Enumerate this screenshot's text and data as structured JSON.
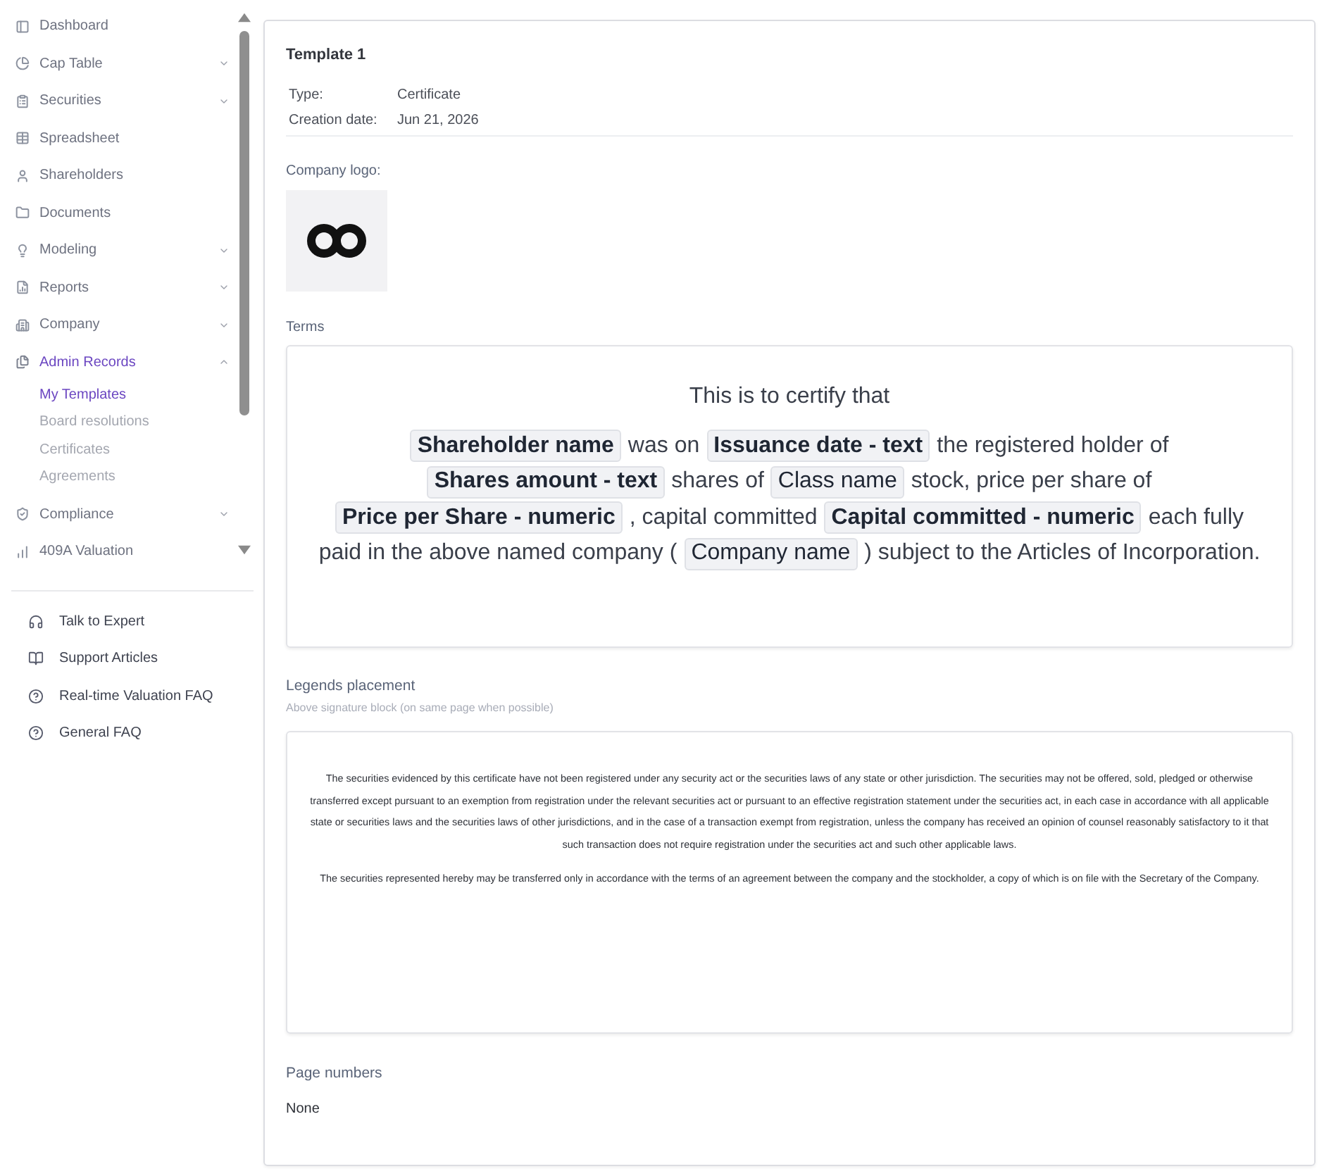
{
  "sidebar": {
    "items": [
      {
        "label": "Dashboard",
        "kind": "link",
        "selected": false
      },
      {
        "label": "Cap Table",
        "kind": "group",
        "selected": false,
        "expanded": false
      },
      {
        "label": "Securities",
        "kind": "group",
        "selected": false,
        "expanded": false
      },
      {
        "label": "Spreadsheet",
        "kind": "link",
        "selected": false
      },
      {
        "label": "Shareholders",
        "kind": "link",
        "selected": false
      },
      {
        "label": "Documents",
        "kind": "link",
        "selected": false
      },
      {
        "label": "Modeling",
        "kind": "group",
        "selected": false,
        "expanded": false
      },
      {
        "label": "Reports",
        "kind": "group",
        "selected": false,
        "expanded": false
      },
      {
        "label": "Company",
        "kind": "group",
        "selected": false,
        "expanded": false
      },
      {
        "label": "Admin Records",
        "kind": "group",
        "selected": true,
        "expanded": true,
        "children": [
          {
            "label": "My Templates",
            "selected": true
          },
          {
            "label": "Board resolutions",
            "selected": false
          },
          {
            "label": "Certificates",
            "selected": false
          },
          {
            "label": "Agreements",
            "selected": false
          }
        ]
      },
      {
        "label": "Compliance",
        "kind": "group",
        "selected": false,
        "expanded": false
      },
      {
        "label": "409A Valuation",
        "kind": "link",
        "selected": false
      }
    ],
    "help_links": [
      {
        "label": "Talk to Expert"
      },
      {
        "label": "Support Articles"
      },
      {
        "label": "Real-time Valuation FAQ"
      },
      {
        "label": "General FAQ"
      }
    ]
  },
  "template": {
    "title": "Template 1",
    "details": [
      {
        "label": "Type:",
        "value": "Certificate"
      },
      {
        "label": "Creation date:",
        "value": "Jun 21, 2026"
      }
    ]
  },
  "company_logo": {
    "label": "Company logo:"
  },
  "terms": {
    "label": "Terms",
    "heading": "This is to certify that",
    "lines": [
      [
        {
          "kind": "field",
          "text": "Shareholder name",
          "bold": true
        },
        {
          "kind": "text",
          "text": "was on"
        },
        {
          "kind": "field",
          "text": "Issuance date - text",
          "bold": true
        },
        {
          "kind": "text",
          "text": "the registered holder of"
        }
      ],
      [
        {
          "kind": "field",
          "text": "Shares amount - text",
          "bold": true
        },
        {
          "kind": "text",
          "text": "shares of"
        },
        {
          "kind": "field",
          "text": "Class name",
          "bold": false
        },
        {
          "kind": "text",
          "text": "stock, price per share of"
        }
      ],
      [
        {
          "kind": "field",
          "text": "Price per Share - numeric",
          "bold": true
        },
        {
          "kind": "text",
          "text": ", capital committed"
        },
        {
          "kind": "field",
          "text": "Capital committed - numeric",
          "bold": true
        },
        {
          "kind": "text",
          "text": "each fully"
        }
      ],
      [
        {
          "kind": "text",
          "text": "paid in the above named company ("
        },
        {
          "kind": "field",
          "text": "Company name",
          "bold": false
        },
        {
          "kind": "text",
          "text": ") subject to the Articles of Incorporation."
        }
      ]
    ]
  },
  "legends": {
    "label": "Legends placement",
    "subtitle": "Above signature block (on same page when possible)",
    "paragraphs": [
      "The securities evidenced by this certificate have not been registered under any security act or the securities laws of any state or other jurisdiction. The securities may not be offered, sold, pledged or otherwise transferred except pursuant to an exemption from registration under the relevant securities act or pursuant to an effective registration statement under the securities act, in each case in accordance with all applicable state or securities laws and the securities laws of other jurisdictions, and in the case of a transaction exempt from registration, unless the company has received an opinion of counsel reasonably satisfactory to it that such transaction does not require registration under the securities act and such other applicable laws.",
      "The securities represented hereby may be transferred only in accordance with the terms of an agreement between the company and the stockholder, a copy of which is on file with the Secretary of the Company."
    ]
  },
  "page_numbers": {
    "label": "Page numbers",
    "value": "None"
  }
}
